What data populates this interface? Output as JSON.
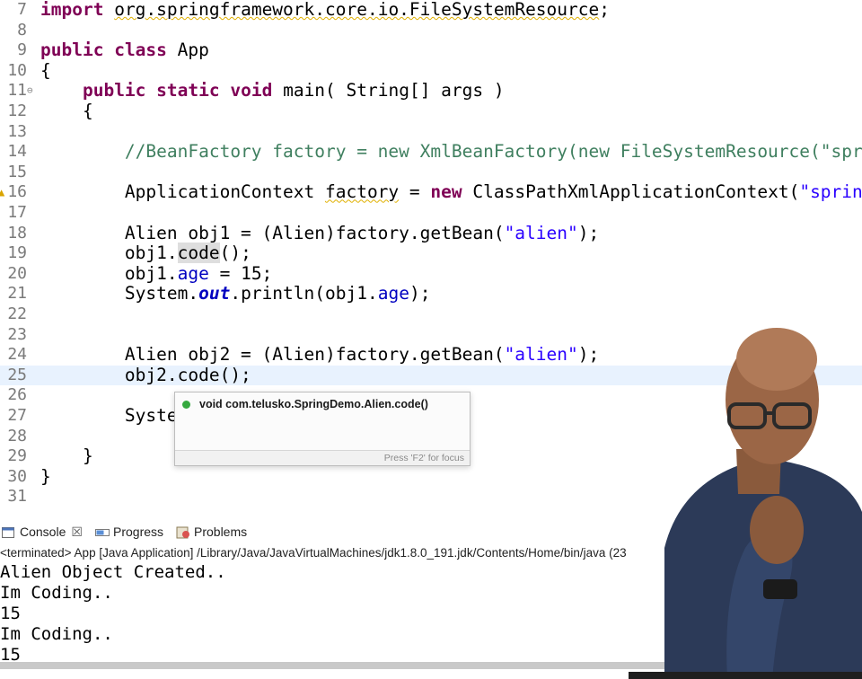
{
  "editor": {
    "lines": [
      {
        "num": "7",
        "html": "<span class=\"kw\">import</span> <span class=\"sq\">org.springframework.core.io.FileSystemResource</span>;"
      },
      {
        "num": "8",
        "html": ""
      },
      {
        "num": "9",
        "html": "<span class=\"kw\">public</span> <span class=\"kw\">class</span> App"
      },
      {
        "num": "10",
        "html": "{"
      },
      {
        "num": "11",
        "html": "    <span class=\"kw\">public</span> <span class=\"kw\">static</span> <span class=\"kw\">void</span> main( String[] args )",
        "marker": "⊖"
      },
      {
        "num": "12",
        "html": "    {"
      },
      {
        "num": "13",
        "html": ""
      },
      {
        "num": "14",
        "html": "        <span class=\"cmt\">//BeanFactory factory = new XmlBeanFactory(new FileSystemResource(\"sprin</span>"
      },
      {
        "num": "15",
        "html": ""
      },
      {
        "num": "16",
        "html": "        ApplicationContext <span class=\"sq\">factory</span> = <span class=\"kw\">new</span> ClassPathXmlApplicationContext(<span class=\"str\">\"spring.</span>",
        "marker": "▲",
        "warn": true
      },
      {
        "num": "17",
        "html": ""
      },
      {
        "num": "18",
        "html": "        Alien obj1 = (Alien)factory.getBean(<span class=\"str\">\"alien\"</span>);"
      },
      {
        "num": "19",
        "html": "        obj1.<span class=\"hl\">code</span>();"
      },
      {
        "num": "20",
        "html": "        obj1.<span class=\"fld\">age</span> = 15;"
      },
      {
        "num": "21",
        "html": "        System.<span class=\"sfld\">out</span>.println(obj1.<span class=\"fld\">age</span>);"
      },
      {
        "num": "22",
        "html": ""
      },
      {
        "num": "23",
        "html": ""
      },
      {
        "num": "24",
        "html": "        Alien obj2 = (Alien)factory.getBean(<span class=\"str\">\"alien\"</span>);"
      },
      {
        "num": "25",
        "html": "        obj2.code();",
        "current": true
      },
      {
        "num": "26",
        "html": ""
      },
      {
        "num": "27",
        "html": "        Syste"
      },
      {
        "num": "28",
        "html": ""
      },
      {
        "num": "29",
        "html": "    }"
      },
      {
        "num": "30",
        "html": "}"
      },
      {
        "num": "31",
        "html": ""
      }
    ]
  },
  "content_assist": {
    "suggestion": "void com.telusko.SpringDemo.Alien.code()",
    "footer": "Press 'F2' for focus"
  },
  "console": {
    "tabs": [
      {
        "label": "Console",
        "icon": "console-icon",
        "close": "☒"
      },
      {
        "label": "Progress",
        "icon": "progress-icon"
      },
      {
        "label": "Problems",
        "icon": "problems-icon"
      }
    ],
    "status": "<terminated> App [Java Application] /Library/Java/JavaVirtualMachines/jdk1.8.0_191.jdk/Contents/Home/bin/java (23",
    "output": [
      "Alien Object Created..",
      "Im Coding..",
      "15",
      "Im Coding..",
      "15"
    ]
  },
  "colors": {
    "keyword": "#7f0055",
    "string": "#2a00ff",
    "comment": "#3f7f5f",
    "field": "#0000c0",
    "current_line": "#e8f2fe"
  }
}
